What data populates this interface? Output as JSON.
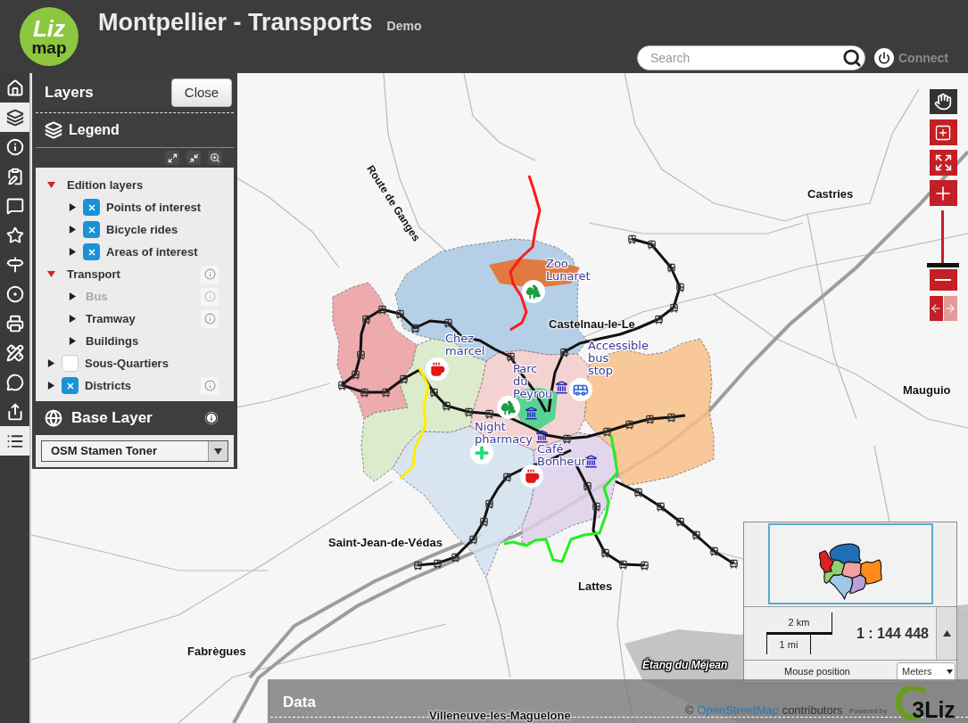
{
  "header": {
    "logo": {
      "top": "Liz",
      "bottom": "map"
    },
    "title": "Montpellier - Transports",
    "subtitle": "Demo",
    "search": {
      "placeholder": "Search"
    },
    "connect": "Connect"
  },
  "toolbar": [
    {
      "selected": false
    },
    {
      "selected": true
    },
    {
      "selected": false
    },
    {
      "selected": false
    },
    {
      "selected": false
    },
    {
      "selected": false
    },
    {
      "selected": false
    },
    {
      "selected": false
    },
    {
      "selected": false
    },
    {
      "selected": false
    },
    {
      "selected": false
    },
    {
      "selected": false
    },
    {
      "selected": true
    }
  ],
  "dock": {
    "title": "Layers",
    "close": "Close",
    "legend": "Legend",
    "layers": [
      {
        "label": "Edition layers",
        "kind": "group",
        "expanded": true,
        "disabled": false,
        "info_button": false,
        "children": [
          {
            "label": "Points of interest",
            "kind": "checkable",
            "checked": true,
            "expanded": false,
            "disabled": false,
            "info_button": false
          },
          {
            "label": "Bicycle rides",
            "kind": "checkable",
            "checked": true,
            "expanded": false,
            "disabled": false,
            "info_button": false
          },
          {
            "label": "Areas of interest",
            "kind": "checkable",
            "checked": true,
            "expanded": false,
            "disabled": false,
            "info_button": false
          }
        ]
      },
      {
        "label": "Transport",
        "kind": "group",
        "expanded": true,
        "disabled": false,
        "info_button": true,
        "children": [
          {
            "label": "Bus",
            "kind": "layer",
            "expanded": false,
            "disabled": true,
            "info_button": true
          },
          {
            "label": "Tramway",
            "kind": "layer",
            "expanded": false,
            "disabled": false,
            "info_button": true
          },
          {
            "label": "Buildings",
            "kind": "layer",
            "expanded": false,
            "disabled": false,
            "info_button": false
          }
        ]
      },
      {
        "label": "Sous-Quartiers",
        "kind": "checkable",
        "checked": false,
        "expanded": false,
        "disabled": false,
        "info_button": false
      },
      {
        "label": "Districts",
        "kind": "checkable",
        "checked": true,
        "expanded": false,
        "disabled": false,
        "info_button": true
      }
    ],
    "base_layer": {
      "title": "Base Layer",
      "value": "OSM Stamen Toner"
    }
  },
  "map": {
    "labels": [
      {
        "text": "Route de Ganges",
        "kind": "road"
      },
      {
        "text": "Castries",
        "kind": "place"
      },
      {
        "text": "Zoo\nLunaret",
        "kind": "poi"
      },
      {
        "text": "Castelnau-le-Le",
        "kind": "place"
      },
      {
        "text": "Chez\nmarcel",
        "kind": "poi"
      },
      {
        "text": "Accessible\nbus\nstop",
        "kind": "poi"
      },
      {
        "text": "Parc\ndu\nPeyrou",
        "kind": "poi"
      },
      {
        "text": "Night\npharmacy",
        "kind": "poi"
      },
      {
        "text": "Café\nBonheur",
        "kind": "poi"
      },
      {
        "text": "Mauguio",
        "kind": "place"
      },
      {
        "text": "Saint-Jean-de-Védas",
        "kind": "place"
      },
      {
        "text": "Lattes",
        "kind": "place"
      },
      {
        "text": "Fabrègues",
        "kind": "place"
      },
      {
        "text": "Étang du Méjean",
        "kind": "water"
      },
      {
        "text": "Villeneuve-lès-Maguelone",
        "kind": "place"
      }
    ],
    "tools": [
      {
        "selected": true
      },
      {
        "selected": false
      }
    ],
    "zoom_slider": {
      "level": 0.02
    },
    "history": [
      {
        "disabled": false
      },
      {
        "disabled": true
      }
    ]
  },
  "overview": {
    "scale_top": "2 km",
    "scale_bottom": "1 mi",
    "scale": "1 : 144 448",
    "mouse_position": "Mouse position",
    "units": "Meters"
  },
  "data_panel": {
    "title": "Data"
  },
  "attribution": {
    "prefix": "©",
    "link": "OpenStreetMap",
    "suffix": "contributors"
  },
  "powered_by": {
    "label": "Powered by",
    "logo": "3Liz"
  }
}
